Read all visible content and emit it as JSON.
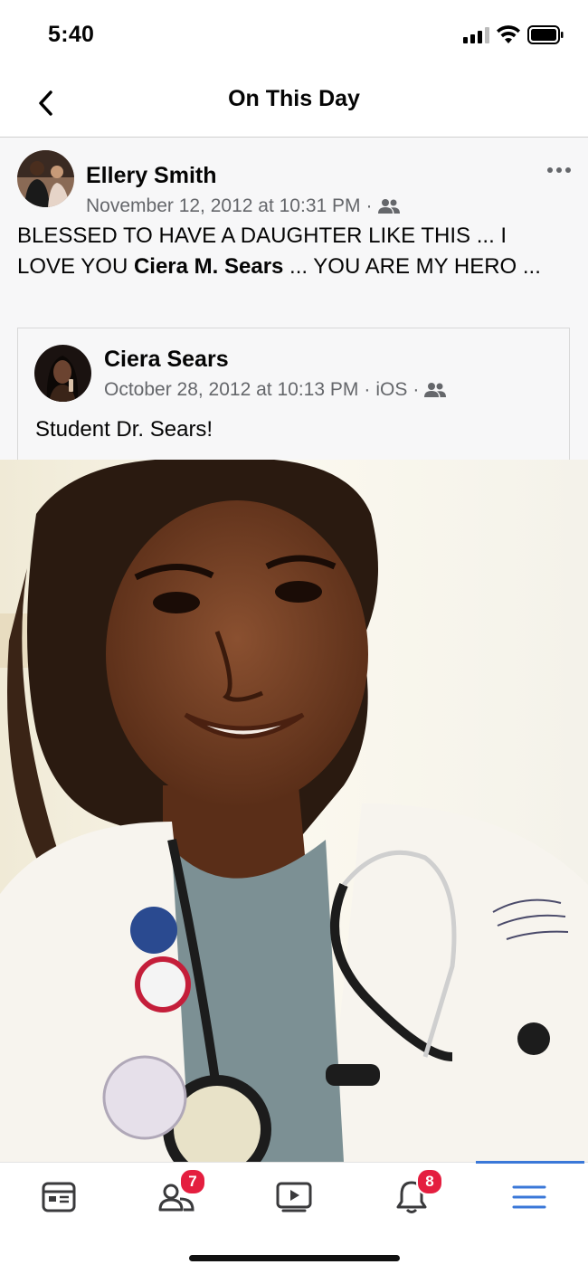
{
  "status_bar": {
    "time": "5:40"
  },
  "nav": {
    "title": "On This Day"
  },
  "post": {
    "author": "Ellery Smith",
    "timestamp": "November 12, 2012 at 10:31 PM",
    "separator": "·",
    "audience_icon": "friends-icon",
    "text_part1": "BLESSED TO HAVE A DAUGHTER LIKE THIS ... I LOVE YOU ",
    "text_tag": "Ciera M. Sears",
    "text_part2": " ... YOU ARE MY HERO ..."
  },
  "shared_post": {
    "author": "Ciera Sears",
    "timestamp": "October 28, 2012 at 10:13 PM",
    "separator": "·",
    "source": "iOS",
    "separator2": "·",
    "audience_icon": "friends-icon",
    "text": "Student Dr. Sears!"
  },
  "tabs": [
    {
      "name": "feed",
      "icon": "news-feed-icon",
      "badge": ""
    },
    {
      "name": "friends",
      "icon": "friends-icon",
      "badge": "7"
    },
    {
      "name": "watch",
      "icon": "video-icon",
      "badge": ""
    },
    {
      "name": "notifications",
      "icon": "bell-icon",
      "badge": "8"
    },
    {
      "name": "menu",
      "icon": "menu-icon",
      "badge": "",
      "active": true
    }
  ],
  "colors": {
    "accent": "#3b78d8",
    "badge": "#e41e3f",
    "meta_text": "#65676b"
  }
}
